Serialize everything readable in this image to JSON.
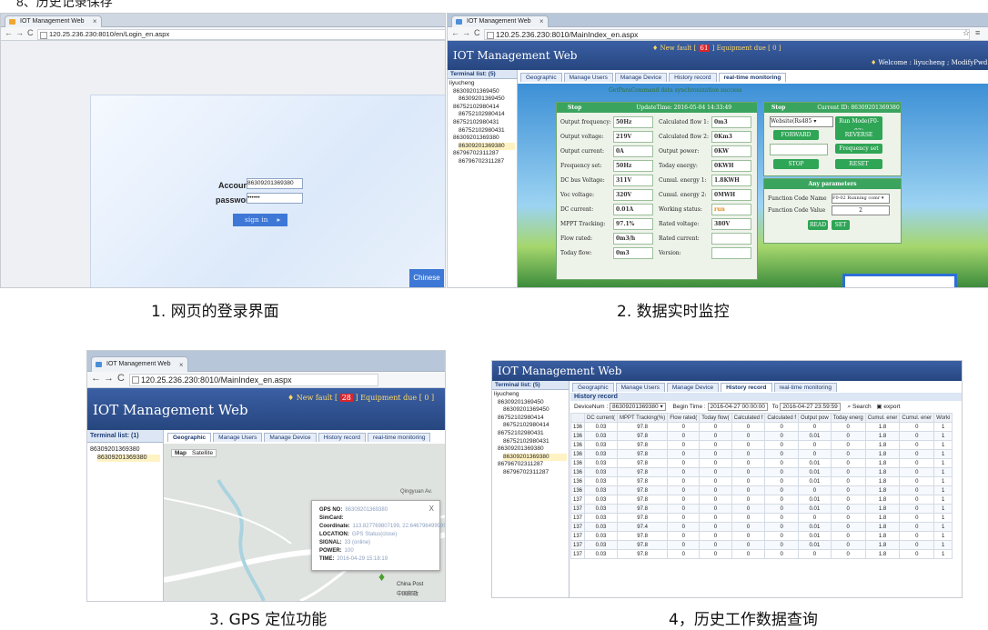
{
  "heading": "8、历史记录保存",
  "captions": [
    "1. 网页的登录界面",
    "2. 数据实时监控",
    "3. GPS 定位功能",
    "4，历史工作数据查询"
  ],
  "browser": {
    "tab_title": "IOT Management Web",
    "login_url": "120.25.236.230:8010/en/Login_en.aspx",
    "main_url": "120.25.236.230:8010/MainIndex_en.aspx"
  },
  "login": {
    "account_label": "Account:",
    "account_value": "86309201369380",
    "password_label": "password:",
    "password_value": "••••••",
    "signin_label": "sign in",
    "chinese_label": "Chinese"
  },
  "app": {
    "title": "IOT Management Web",
    "new_fault_label": "New fault",
    "equipment_due_label": "Equipment due",
    "fault_count_2": "61",
    "due_count_2": "0",
    "fault_count_3": "28",
    "due_count_3": "0",
    "welcome": "Welcome : liyucheng ;",
    "modify_exit": "ModifyPwd Exit",
    "terminal_list_5": "Terminal list: (5)",
    "terminal_list_1": "Terminal list: (1)",
    "tabs": [
      "Geographic",
      "Manage Users",
      "Manage Device",
      "History record",
      "real-time monitoring"
    ]
  },
  "tree": [
    "liyucheng",
    "86309201369450",
    "86309201369450",
    "86752102980414",
    "86752102980414",
    "86752102980431",
    "86752102980431",
    "86309201369380",
    "86309201369380",
    "86796702311287",
    "86796702311287"
  ],
  "monitor": {
    "banner": "GetParaCommand data synchronization success",
    "stop": "Stop",
    "update_time": "UpdateTime: 2016-05-04 14:33:49",
    "left_rows": [
      {
        "label": "Output frequency:",
        "value": "50Hz"
      },
      {
        "label": "Output voltage:",
        "value": "219V"
      },
      {
        "label": "Output current:",
        "value": "0A"
      },
      {
        "label": "Frequency set:",
        "value": "50Hz"
      },
      {
        "label": "DC bus Voltage:",
        "value": "311V"
      },
      {
        "label": "Voc voltage:",
        "value": "320V"
      },
      {
        "label": "DC current:",
        "value": "0.01A"
      },
      {
        "label": "MPPT Tracking:",
        "value": "97.1%"
      },
      {
        "label": "Flow rated:",
        "value": "0m3/h"
      },
      {
        "label": "Today flow:",
        "value": "0m3"
      }
    ],
    "mid_rows": [
      {
        "label": "Calculated flow 1:",
        "value": "0m3"
      },
      {
        "label": "Calculated flow 2:",
        "value": "0Km3"
      },
      {
        "label": "Output power:",
        "value": "0KW"
      },
      {
        "label": "Today energy:",
        "value": "0KWH"
      },
      {
        "label": "Cumul. energy 1:",
        "value": "1.8KWH"
      },
      {
        "label": "Cumul. energy 2:",
        "value": "0MWH"
      },
      {
        "label": "Working status:",
        "value": "run"
      },
      {
        "label": "Rated voltage:",
        "value": "380V"
      },
      {
        "label": "Rated current:",
        "value": ""
      },
      {
        "label": "Version:",
        "value": ""
      }
    ],
    "current_id": "Current ID: 86309201369380",
    "website_select": "Website(Rs485",
    "run_mode": "Run Mode(F0-02)",
    "forward": "FORWARD",
    "reverse": "REVERSE",
    "frequency_set": "Frequency set",
    "stop_btn": "STOP",
    "reset": "RESET",
    "any_params": "Any parameters",
    "function_code_name_label": "Function Code Name",
    "function_code_name_value": "F0-02 Running comr",
    "function_code_value_label": "Function Code Value",
    "function_code_value": "2",
    "read": "READ",
    "set": "SET"
  },
  "gps": {
    "map_tab": "Map",
    "satellite_tab": "Satellite",
    "gps_no": "GPS NO:",
    "gps_no_val": "86309201369380",
    "simcard": "SimCard:",
    "coordinate": "Coordinate:",
    "coordinate_val": "113.827769807199, 22.6467984999950",
    "location": "LOCATION:",
    "location_val": "GPS Status(close)",
    "signal": "SIGNAL:",
    "signal_val": "33 (online)",
    "power": "POWER:",
    "power_val": "100",
    "time": "TIME:",
    "time_val": "2016-04-29 15:18:19",
    "close": "X",
    "place1": "Qingyuan Av.",
    "place2": "China Post",
    "place3": "中国邮政"
  },
  "history": {
    "title": "History record",
    "devicenum_label": "DeviceNum :",
    "devicenum_value": "86309201369380",
    "begin_label": "Begin Time :",
    "begin_value": "2016-04-27 00:00:00",
    "to_label": "To",
    "to_value": "2016-04-27 23:59:59",
    "search": "Search",
    "export": "export",
    "columns": [
      "DC current(",
      "MPPT Tracking(%)",
      "Flow rated(",
      "Today flow(",
      "Calculated f",
      "Calculated f",
      "Output pow",
      "Today energ",
      "Cumul. ener",
      "Cumul. ener",
      "Worki"
    ],
    "rows": [
      [
        "136",
        "0.03",
        "97.8",
        "0",
        "0",
        "0",
        "0",
        "0",
        "0",
        "1.8",
        "0",
        "1"
      ],
      [
        "136",
        "0.03",
        "97.8",
        "0",
        "0",
        "0",
        "0",
        "0.01",
        "0",
        "1.8",
        "0",
        "1"
      ],
      [
        "136",
        "0.03",
        "97.8",
        "0",
        "0",
        "0",
        "0",
        "0",
        "0",
        "1.8",
        "0",
        "1"
      ],
      [
        "136",
        "0.03",
        "97.8",
        "0",
        "0",
        "0",
        "0",
        "0",
        "0",
        "1.8",
        "0",
        "1"
      ],
      [
        "136",
        "0.03",
        "97.8",
        "0",
        "0",
        "0",
        "0",
        "0.01",
        "0",
        "1.8",
        "0",
        "1"
      ],
      [
        "136",
        "0.03",
        "97.8",
        "0",
        "0",
        "0",
        "0",
        "0.01",
        "0",
        "1.8",
        "0",
        "1"
      ],
      [
        "136",
        "0.03",
        "97.8",
        "0",
        "0",
        "0",
        "0",
        "0.01",
        "0",
        "1.8",
        "0",
        "1"
      ],
      [
        "136",
        "0.03",
        "97.8",
        "0",
        "0",
        "0",
        "0",
        "0",
        "0",
        "1.8",
        "0",
        "1"
      ],
      [
        "137",
        "0.03",
        "97.8",
        "0",
        "0",
        "0",
        "0",
        "0.01",
        "0",
        "1.8",
        "0",
        "1"
      ],
      [
        "137",
        "0.03",
        "97.8",
        "0",
        "0",
        "0",
        "0",
        "0.01",
        "0",
        "1.8",
        "0",
        "1"
      ],
      [
        "137",
        "0.03",
        "97.8",
        "0",
        "0",
        "0",
        "0",
        "0",
        "0",
        "1.8",
        "0",
        "1"
      ],
      [
        "137",
        "0.03",
        "97.4",
        "0",
        "0",
        "0",
        "0",
        "0.01",
        "0",
        "1.8",
        "0",
        "1"
      ],
      [
        "137",
        "0.03",
        "97.8",
        "0",
        "0",
        "0",
        "0",
        "0.01",
        "0",
        "1.8",
        "0",
        "1"
      ],
      [
        "137",
        "0.03",
        "97.8",
        "0",
        "0",
        "0",
        "0",
        "0.01",
        "0",
        "1.8",
        "0",
        "1"
      ],
      [
        "137",
        "0.03",
        "97.8",
        "0",
        "0",
        "0",
        "0",
        "0",
        "0",
        "1.8",
        "0",
        "1"
      ]
    ]
  }
}
